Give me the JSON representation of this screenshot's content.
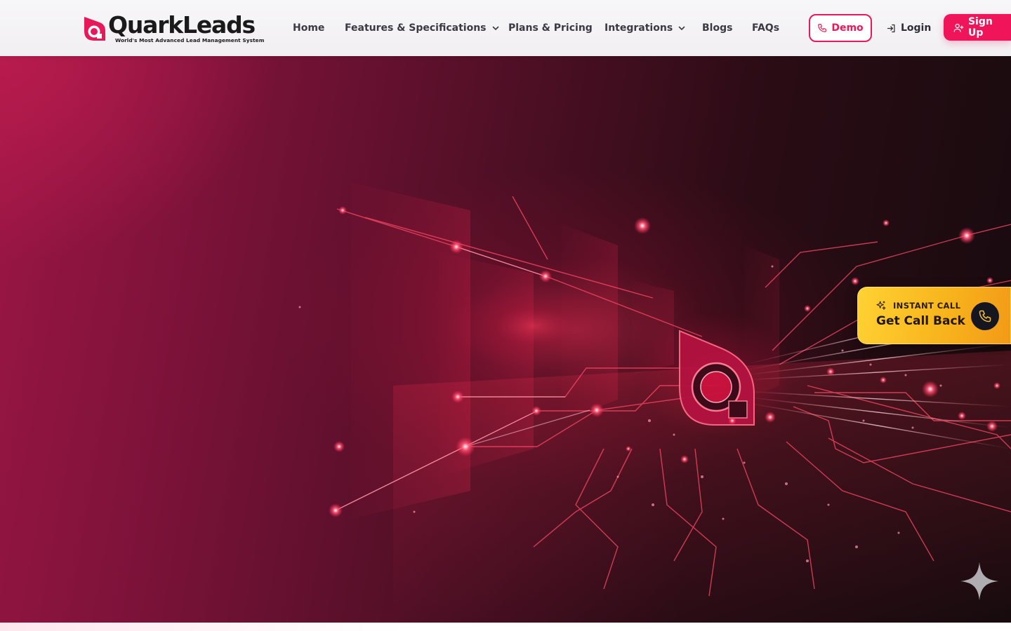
{
  "header": {
    "logo": {
      "name": "QuarkLeads",
      "tagline": "World's Most Advanced Lead Management System"
    },
    "nav": [
      {
        "label": "Home",
        "has_dropdown": false
      },
      {
        "label": "Features & Specifications",
        "has_dropdown": true
      },
      {
        "label": "Plans & Pricing",
        "has_dropdown": false
      },
      {
        "label": "Integrations",
        "has_dropdown": true
      },
      {
        "label": "Blogs",
        "has_dropdown": false
      },
      {
        "label": "FAQs",
        "has_dropdown": false
      }
    ],
    "actions": {
      "demo_label": "Demo",
      "login_label": "Login",
      "signup_label": "Sign Up"
    }
  },
  "callback_widget": {
    "kicker": "INSTANT CALL",
    "title": "Get Call Back",
    "icon": "phone-icon"
  },
  "floating": {
    "icon": "sparkle-star-icon"
  },
  "colors": {
    "brand_pink": "#e8195a",
    "signup_bg": "#f0145a",
    "callback_yellow": "#f8b51c",
    "hero_dark": "#160b0e",
    "hero_crimson": "#9c1645"
  }
}
